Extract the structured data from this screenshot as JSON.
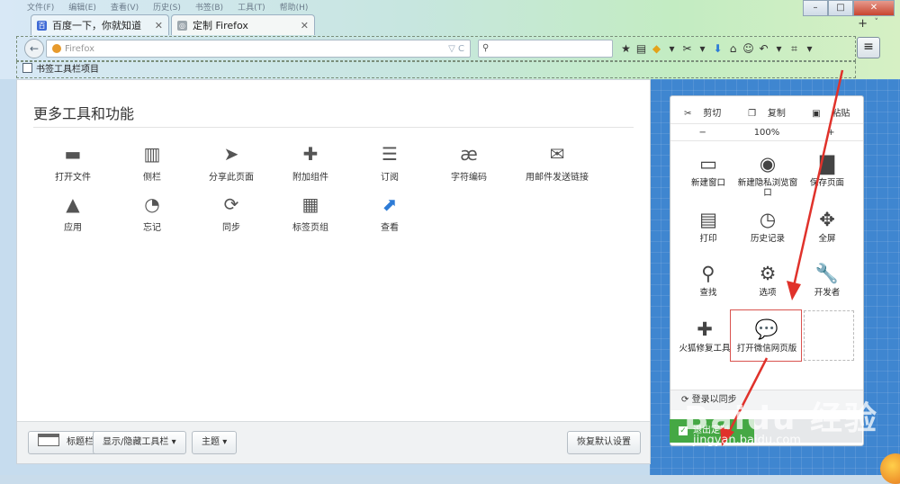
{
  "menubar": [
    "文件(F)",
    "编辑(E)",
    "查看(V)",
    "历史(S)",
    "书签(B)",
    "工具(T)",
    "帮助(H)"
  ],
  "tabs": [
    {
      "title": "百度一下，你就知道",
      "favicon": "百"
    },
    {
      "title": "定制 Firefox",
      "favicon": "◎"
    }
  ],
  "tab_new": "+",
  "tab_list": "˅",
  "window_controls": {
    "minimize": "–",
    "maximize": "□",
    "close": "✕"
  },
  "nav": {
    "back_icon": "back-arrow-icon",
    "url_placeholder": "Firefox",
    "url_tail": "▽ C",
    "search_icon": "search-icon",
    "toolbar_icons": [
      "★",
      "▤",
      "◆",
      "▾",
      "✂",
      "▾",
      "⬇",
      "⌂",
      "☺",
      "↶",
      "▾",
      "⌗",
      "▾"
    ]
  },
  "bookmarks_label": "书签工具栏项目",
  "main": {
    "title": "更多工具和功能",
    "items": [
      {
        "label": "打开文件",
        "icon": "▬"
      },
      {
        "label": "侧栏",
        "icon": "▥"
      },
      {
        "label": "分享此页面",
        "icon": "➤"
      },
      {
        "label": "附加组件",
        "icon": "✚"
      },
      {
        "label": "订阅",
        "icon": "☰"
      },
      {
        "label": "字符编码",
        "icon": "æ"
      },
      {
        "label": "用邮件发送链接",
        "icon": "✉"
      },
      {
        "label": "应用",
        "icon": "▲"
      },
      {
        "label": "忘记",
        "icon": "◔"
      },
      {
        "label": "同步",
        "icon": "⟳"
      },
      {
        "label": "标签页组",
        "icon": "▦"
      },
      {
        "label": "查看",
        "icon": "⬈"
      }
    ]
  },
  "footer": {
    "titlebar": "标题栏",
    "toolbars": "显示/隐藏工具栏",
    "theme": "主题",
    "restore": "恢复默认设置"
  },
  "panel": {
    "cut": "剪切",
    "copy": "复制",
    "paste": "粘贴",
    "zoom_out": "−",
    "zoom_level": "100%",
    "zoom_in": "+",
    "items": [
      {
        "label": "新建窗口",
        "icon": "▭"
      },
      {
        "label": "新建隐私浏览窗口",
        "icon": "◉"
      },
      {
        "label": "保存页面",
        "icon": "▇"
      },
      {
        "label": "打印",
        "icon": "▤"
      },
      {
        "label": "历史记录",
        "icon": "◷"
      },
      {
        "label": "全屏",
        "icon": "✥"
      },
      {
        "label": "查找",
        "icon": "⚲"
      },
      {
        "label": "选项",
        "icon": "⚙"
      },
      {
        "label": "开发者",
        "icon": "🔧"
      },
      {
        "label": "火狐修复工具",
        "icon": "✚"
      },
      {
        "label": "打开微信网页版",
        "icon": "💬"
      }
    ],
    "sync": "登录以同步",
    "exit": "退出定制"
  },
  "watermark": {
    "brand": "Baidu 经验",
    "url": "jingyan.baidu.com"
  },
  "colors": {
    "accent_green": "#45a844",
    "highlight_red": "#d9534f",
    "panel_blue": "#3f86d0"
  }
}
